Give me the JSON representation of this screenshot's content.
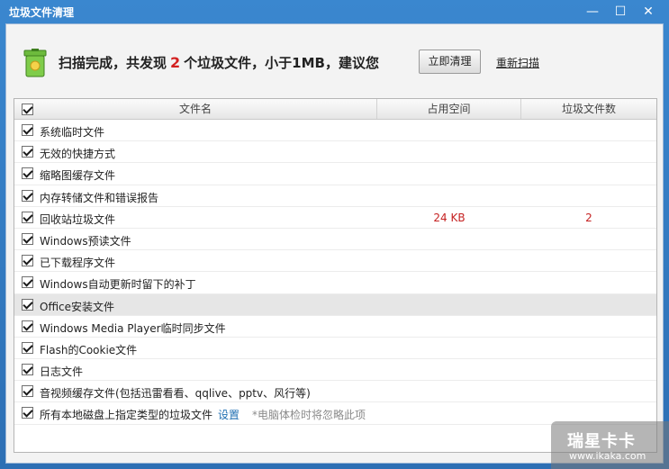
{
  "window": {
    "title": "垃圾文件清理",
    "controls": {
      "minimize": "—",
      "maximize": "☐",
      "close": "✕"
    }
  },
  "summary": {
    "prefix": "扫描完成，共发现",
    "count": "2",
    "suffix": "个垃圾文件，小于1MB，建议您",
    "clean_button": "立即清理",
    "rescan_link": "重新扫描",
    "icon": "trash-bin-icon"
  },
  "table": {
    "headers": {
      "name": "文件名",
      "space": "占用空间",
      "count": "垃圾文件数"
    },
    "rows": [
      {
        "name": "系统临时文件",
        "space": "",
        "count": ""
      },
      {
        "name": "无效的快捷方式",
        "space": "",
        "count": ""
      },
      {
        "name": "缩略图缓存文件",
        "space": "",
        "count": ""
      },
      {
        "name": "内存转储文件和错误报告",
        "space": "",
        "count": ""
      },
      {
        "name": "回收站垃圾文件",
        "space": "24 KB",
        "count": "2"
      },
      {
        "name": "Windows预读文件",
        "space": "",
        "count": ""
      },
      {
        "name": "已下载程序文件",
        "space": "",
        "count": ""
      },
      {
        "name": "Windows自动更新时留下的补丁",
        "space": "",
        "count": ""
      },
      {
        "name": "Office安装文件",
        "space": "",
        "count": ""
      },
      {
        "name": "Windows Media Player临时同步文件",
        "space": "",
        "count": ""
      },
      {
        "name": "Flash的Cookie文件",
        "space": "",
        "count": ""
      },
      {
        "name": "日志文件",
        "space": "",
        "count": ""
      },
      {
        "name": "音视频缓存文件(包括迅雷看看、qqlive、pptv、风行等)",
        "space": "",
        "count": ""
      },
      {
        "name": "所有本地磁盘上指定类型的垃圾文件",
        "space": "",
        "count": "",
        "link": "设置",
        "note": "*电脑体检时将忽略此项"
      }
    ]
  },
  "watermark": {
    "main": "瑞星卡卡",
    "url": "www.ikaka.com"
  },
  "colors": {
    "titlebar": "#2d6fb4",
    "count_red": "#d32020",
    "link_blue": "#1f6fb2"
  }
}
